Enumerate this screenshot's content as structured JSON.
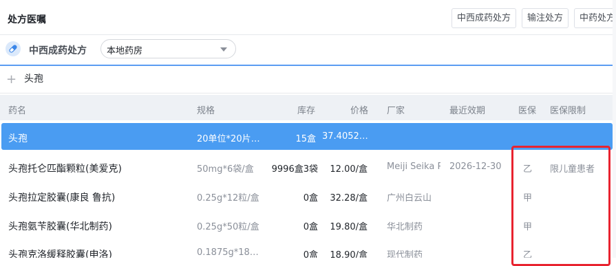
{
  "header": {
    "title": "处方医嘱",
    "tabs": [
      "中西成药处方",
      "输注处方",
      "中药处方"
    ]
  },
  "subbar": {
    "label": "中西成药处方",
    "pharmacy_select": "本地药房"
  },
  "search": {
    "value": "头孢"
  },
  "table": {
    "headers": {
      "name": "药名",
      "spec": "规格",
      "stock": "库存",
      "price": "价格",
      "manufacturer": "厂家",
      "expiry": "最近效期",
      "insurance": "医保",
      "restriction": "医保限制"
    },
    "rows": [
      {
        "name": "头孢",
        "spec": "20单位*20片…",
        "stock": "15盒",
        "price": "37.4052…",
        "manufacturer": "",
        "expiry": "",
        "insurance": "",
        "restriction": ""
      },
      {
        "name": "头孢托仑匹酯颗粒(美爱克)",
        "spec": "50mg*6袋/盒",
        "stock": "9996盒3袋",
        "price": "12.00/盒",
        "manufacturer": "Meiji Seika Pharma",
        "expiry": "2026-12-30",
        "insurance": "乙",
        "restriction": "限儿童患者"
      },
      {
        "name": "头孢拉定胶囊(康良 鲁抗)",
        "spec": "0.25g*12粒/盒",
        "stock": "0盒",
        "price": "32.28/盒",
        "manufacturer": "广州白云山",
        "expiry": "",
        "insurance": "甲",
        "restriction": ""
      },
      {
        "name": "头孢氨苄胶囊(华北制药)",
        "spec": "0.25g*50粒/盒",
        "stock": "0盒",
        "price": "19.80/盒",
        "manufacturer": "华北制药",
        "expiry": "",
        "insurance": "甲",
        "restriction": ""
      },
      {
        "name": "头孢克洛缓释胶囊(申洛)",
        "spec": "0.1875g*18…",
        "stock": "0盒",
        "price": "18.90/盒",
        "manufacturer": "现代制药",
        "expiry": "",
        "insurance": "乙",
        "restriction": ""
      }
    ],
    "selected_row": 0
  },
  "colors": {
    "accent": "#4a9cf2",
    "highlight_box": "#e8232f",
    "header_bg": "#eef1f5"
  }
}
